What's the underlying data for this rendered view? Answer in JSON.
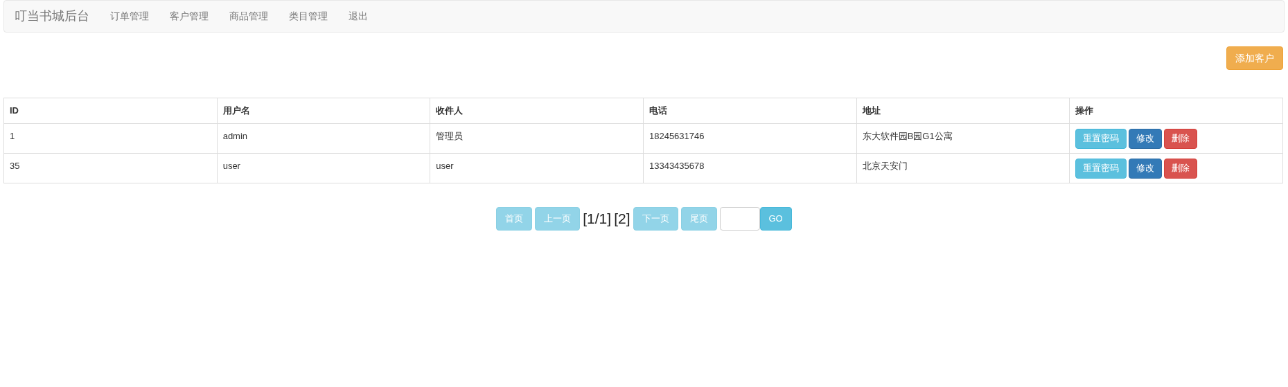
{
  "navbar": {
    "brand": "叮当书城后台",
    "items": [
      "订单管理",
      "客户管理",
      "商品管理",
      "类目管理",
      "退出"
    ]
  },
  "add_button": "添加客户",
  "table": {
    "columns": [
      "ID",
      "用户名",
      "收件人",
      "电话",
      "地址",
      "操作"
    ],
    "rows": [
      {
        "cells": [
          "1",
          "admin",
          "管理员",
          "18245631746",
          "东大软件园B园G1公寓"
        ],
        "actions": [
          {
            "label": "重置密码",
            "kind": "info"
          },
          {
            "label": "修改",
            "kind": "primary"
          },
          {
            "label": "删除",
            "kind": "danger"
          }
        ]
      },
      {
        "cells": [
          "35",
          "user",
          "user",
          "13343435678",
          "北京天安门"
        ],
        "actions": [
          {
            "label": "重置密码",
            "kind": "info"
          },
          {
            "label": "修改",
            "kind": "primary"
          },
          {
            "label": "删除",
            "kind": "danger"
          }
        ]
      }
    ]
  },
  "pager": [
    {
      "kind": "button",
      "label": "首页",
      "disabled": true
    },
    {
      "kind": "button",
      "label": "上一页",
      "disabled": true
    },
    {
      "kind": "text",
      "label": "[1/1]"
    },
    {
      "kind": "text",
      "label": "[2]"
    },
    {
      "kind": "button",
      "label": "下一页",
      "disabled": true
    },
    {
      "kind": "button",
      "label": "尾页",
      "disabled": true
    },
    {
      "kind": "input"
    },
    {
      "kind": "button",
      "label": "GO",
      "disabled": false
    }
  ]
}
